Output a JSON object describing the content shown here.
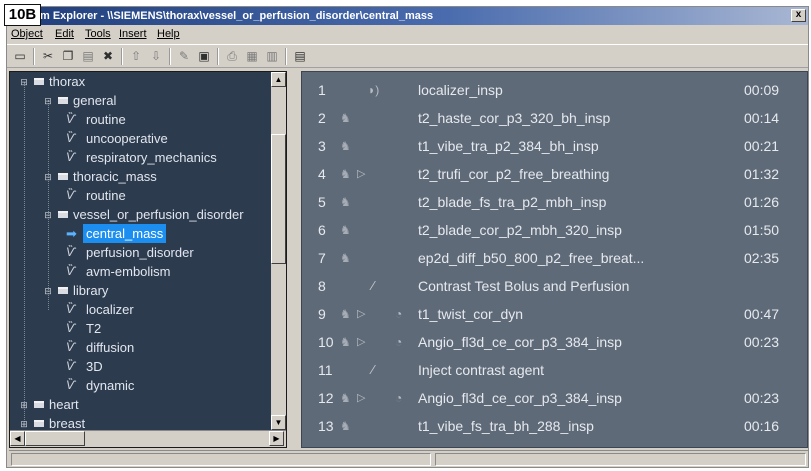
{
  "figure_label": "10B",
  "window": {
    "title": "m Explorer - \\\\SIEMENS\\thorax\\vessel_or_perfusion_disorder\\central_mass",
    "close_label": "x"
  },
  "menu": [
    {
      "label": "Object"
    },
    {
      "label": "Edit"
    },
    {
      "label": "Tools"
    },
    {
      "label": "Insert"
    },
    {
      "label": "Help"
    }
  ],
  "toolbar": {
    "buttons": [
      {
        "icon": "window-icon"
      },
      {
        "icon": "cut-icon"
      },
      {
        "icon": "copy-icon"
      },
      {
        "icon": "paste-icon"
      },
      {
        "icon": "delete-icon"
      },
      {
        "icon": "move-up-icon"
      },
      {
        "icon": "move-down-icon"
      },
      {
        "icon": "edit-icon"
      },
      {
        "icon": "save-icon"
      },
      {
        "icon": "print-icon"
      },
      {
        "icon": "properties-icon"
      },
      {
        "icon": "export-icon"
      },
      {
        "icon": "view-icon"
      }
    ]
  },
  "tree": {
    "items": [
      {
        "label": "thorax",
        "type": "folder",
        "level": 0,
        "expanded": true
      },
      {
        "label": "general",
        "type": "folder",
        "level": 1,
        "expanded": true
      },
      {
        "label": "routine",
        "type": "protocol",
        "level": 2
      },
      {
        "label": "uncooperative",
        "type": "protocol",
        "level": 2
      },
      {
        "label": "respiratory_mechanics",
        "type": "protocol",
        "level": 2
      },
      {
        "label": "thoracic_mass",
        "type": "folder",
        "level": 1,
        "expanded": true
      },
      {
        "label": "routine",
        "type": "protocol",
        "level": 2
      },
      {
        "label": "vessel_or_perfusion_disorder",
        "type": "folder",
        "level": 1,
        "expanded": true
      },
      {
        "label": "central_mass",
        "type": "protocol",
        "level": 2,
        "selected": true
      },
      {
        "label": "perfusion_disorder",
        "type": "protocol",
        "level": 2
      },
      {
        "label": "avm-embolism",
        "type": "protocol",
        "level": 2
      },
      {
        "label": "library",
        "type": "folder",
        "level": 1,
        "expanded": true
      },
      {
        "label": "localizer",
        "type": "protocol",
        "level": 2
      },
      {
        "label": "T2",
        "type": "protocol",
        "level": 2
      },
      {
        "label": "diffusion",
        "type": "protocol",
        "level": 2
      },
      {
        "label": "3D",
        "type": "protocol",
        "level": 2
      },
      {
        "label": "dynamic",
        "type": "protocol",
        "level": 2
      },
      {
        "label": "heart",
        "type": "folder",
        "level": 0,
        "expanded": false
      },
      {
        "label": "breast",
        "type": "folder",
        "level": 0,
        "expanded": false
      }
    ]
  },
  "protocols": [
    {
      "num": "1",
      "name": "localizer_insp",
      "time": "00:09",
      "breath": false,
      "play": false,
      "extra": "speaker",
      "pause": false
    },
    {
      "num": "2",
      "name": "t2_haste_cor_p3_320_bh_insp",
      "time": "00:14",
      "breath": true,
      "play": false,
      "extra": "",
      "pause": false
    },
    {
      "num": "3",
      "name": "t1_vibe_tra_p2_384_bh_insp",
      "time": "00:21",
      "breath": true,
      "play": false,
      "extra": "",
      "pause": false
    },
    {
      "num": "4",
      "name": "t2_trufi_cor_p2_free_breathing",
      "time": "01:32",
      "breath": true,
      "play": true,
      "extra": "",
      "pause": false
    },
    {
      "num": "5",
      "name": "t2_blade_fs_tra_p2_mbh_insp",
      "time": "01:26",
      "breath": true,
      "play": false,
      "extra": "",
      "pause": false
    },
    {
      "num": "6",
      "name": "t2_blade_cor_p2_mbh_320_insp",
      "time": "01:50",
      "breath": true,
      "play": false,
      "extra": "",
      "pause": false
    },
    {
      "num": "7",
      "name": "ep2d_diff_b50_800_p2_free_breat...",
      "time": "02:35",
      "breath": true,
      "play": false,
      "extra": "",
      "pause": false
    },
    {
      "num": "8",
      "name": "Contrast Test Bolus and Perfusion",
      "time": "",
      "breath": false,
      "play": false,
      "extra": "",
      "pause": true
    },
    {
      "num": "9",
      "name": "t1_twist_cor_dyn",
      "time": "00:47",
      "breath": true,
      "play": true,
      "extra": "contrast",
      "pause": false
    },
    {
      "num": "10",
      "name": "Angio_fl3d_ce_cor_p3_384_insp",
      "time": "00:23",
      "breath": true,
      "play": true,
      "extra": "contrast",
      "pause": false
    },
    {
      "num": "11",
      "name": "Inject contrast agent",
      "time": "",
      "breath": false,
      "play": false,
      "extra": "",
      "pause": true
    },
    {
      "num": "12",
      "name": "Angio_fl3d_ce_cor_p3_384_insp",
      "time": "00:23",
      "breath": true,
      "play": true,
      "extra": "contrast",
      "pause": false
    },
    {
      "num": "13",
      "name": "t1_vibe_fs_tra_bh_288_insp",
      "time": "00:16",
      "breath": true,
      "play": false,
      "extra": "",
      "pause": false
    }
  ],
  "colors": {
    "tree_bg": "#2c3b4e",
    "protocol_bg": "#5f6a79",
    "selection": "#1c8ef0",
    "chrome": "#d4d0c8"
  }
}
